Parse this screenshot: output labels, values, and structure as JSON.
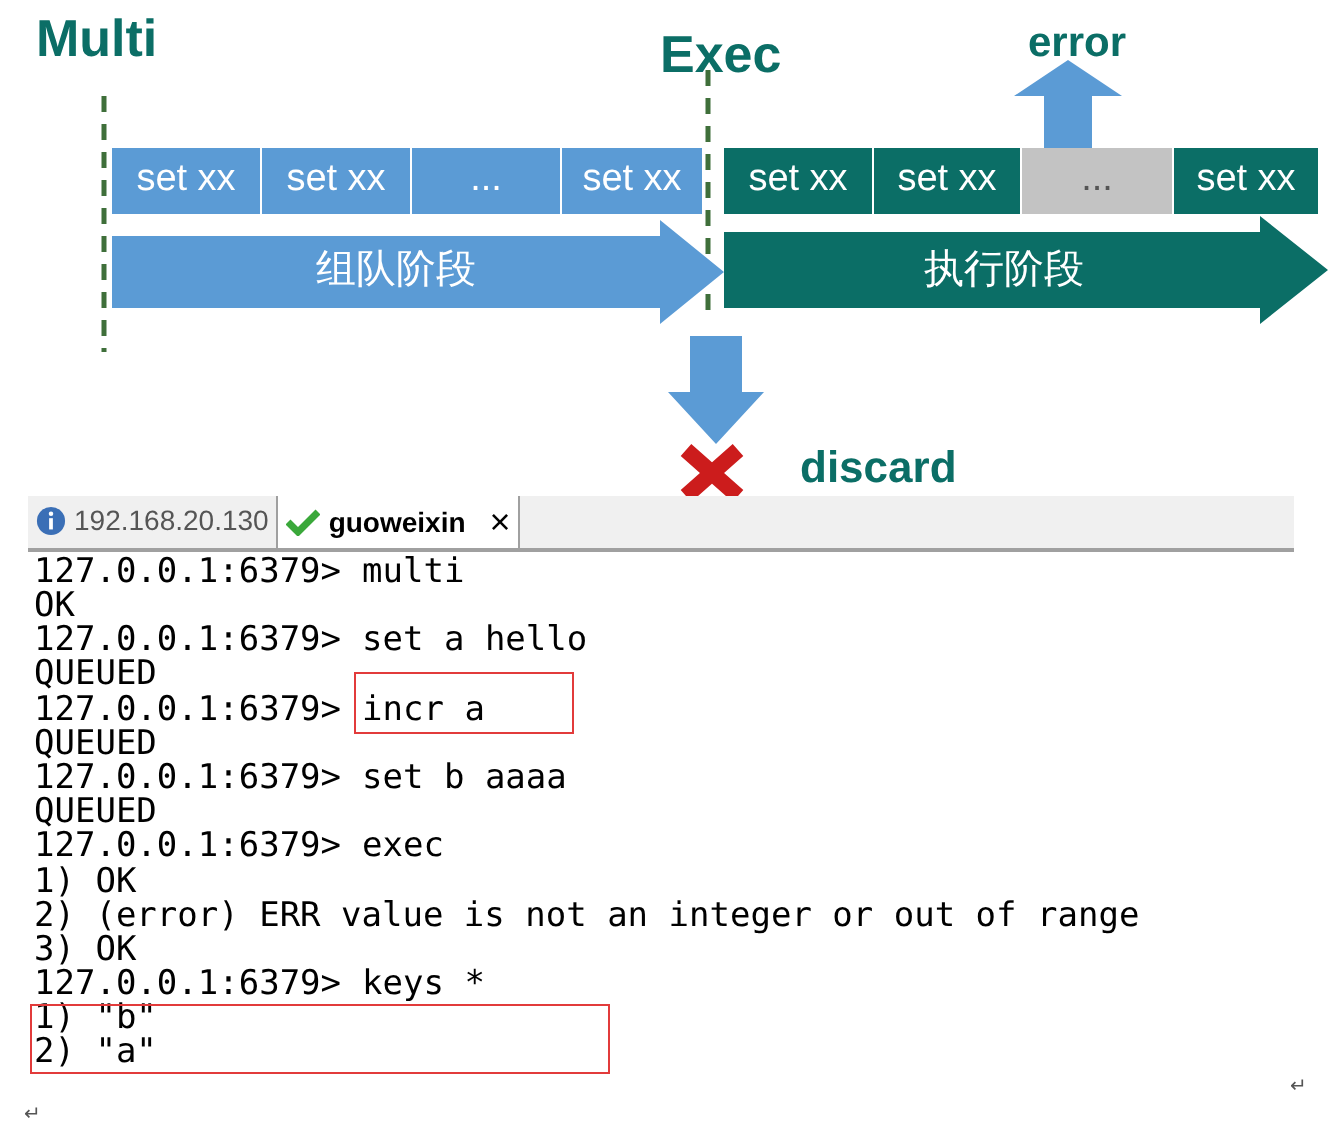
{
  "diagram": {
    "multi_label": "Multi",
    "exec_label": "Exec",
    "error_label": "error",
    "discard_label": "discard",
    "queue_phase": "组队阶段",
    "exec_phase": "执行阶段",
    "queue_blocks": [
      {
        "text": "set xx"
      },
      {
        "text": "set xx"
      },
      {
        "text": "..."
      },
      {
        "text": "set xx"
      }
    ],
    "exec_blocks": [
      {
        "text": "set xx",
        "kind": "command"
      },
      {
        "text": "set xx",
        "kind": "command"
      },
      {
        "text": "...",
        "kind": "error"
      },
      {
        "text": "set xx",
        "kind": "command"
      }
    ]
  },
  "terminal": {
    "tabs": [
      {
        "label": "192.168.20.130",
        "selected": false,
        "kind": "info"
      },
      {
        "label": "guoweixin",
        "selected": true,
        "kind": "check"
      }
    ],
    "close_label": "×",
    "lines": [
      {
        "kind": "prompt",
        "prompt": "127.0.0.1:6379>",
        "command": "multi",
        "highlighted": false
      },
      {
        "kind": "output",
        "text": "OK",
        "highlighted": false
      },
      {
        "kind": "prompt",
        "prompt": "127.0.0.1:6379>",
        "command": "set a hello",
        "highlighted": false
      },
      {
        "kind": "output",
        "text": "QUEUED",
        "highlighted": false
      },
      {
        "kind": "prompt",
        "prompt": "127.0.0.1:6379>",
        "command": "incr a",
        "highlighted": true
      },
      {
        "kind": "output",
        "text": "QUEUED",
        "highlighted": false
      },
      {
        "kind": "prompt",
        "prompt": "127.0.0.1:6379>",
        "command": "set b aaaa",
        "highlighted": false
      },
      {
        "kind": "output",
        "text": "QUEUED",
        "highlighted": false
      },
      {
        "kind": "prompt",
        "prompt": "127.0.0.1:6379>",
        "command": "exec",
        "highlighted": false
      },
      {
        "kind": "output",
        "text": "1) OK",
        "highlighted": false
      },
      {
        "kind": "output",
        "text": "2) (error) ERR value is not an integer or out of range",
        "highlighted": false
      },
      {
        "kind": "output",
        "text": "3) OK",
        "highlighted": false
      },
      {
        "kind": "prompt",
        "prompt": "127.0.0.1:6379>",
        "command": "keys *",
        "highlighted": false
      },
      {
        "kind": "output",
        "text": "1) \"b\"",
        "highlighted": true
      },
      {
        "kind": "output",
        "text": "2) \"a\"",
        "highlighted": true
      }
    ]
  },
  "paragraph_marks": [
    "↵",
    "↵"
  ]
}
